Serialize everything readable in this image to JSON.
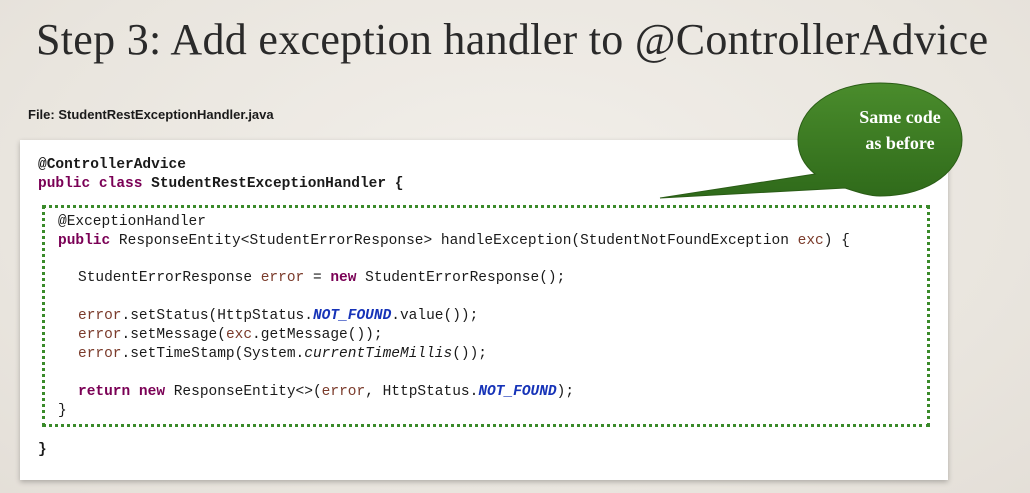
{
  "slide": {
    "title": "Step 3:  Add exception handler to @ControllerAdvice",
    "file_label": "File: StudentRestExceptionHandler.java"
  },
  "callout": {
    "line1": "Same code",
    "line2": "as before"
  },
  "code": {
    "annotation_outer": "@ControllerAdvice",
    "class_kw": "public class ",
    "class_name": "StudentRestExceptionHandler {",
    "annotation_inner": "@ExceptionHandler",
    "method_kw": "public",
    "method_sig": " ResponseEntity<StudentErrorResponse> handleException(StudentNotFoundException ",
    "method_param": "exc",
    "method_end": ") {",
    "line_new_a": "StudentErrorResponse ",
    "line_new_var": "error",
    "line_new_b": " = ",
    "line_new_kw": "new",
    "line_new_c": " StudentErrorResponse();",
    "status_var": "error",
    "status_a": ".setStatus(HttpStatus.",
    "status_const": "NOT_FOUND",
    "status_b": ".value());",
    "msg_var": "error",
    "msg_a": ".setMessage(",
    "msg_param": "exc",
    "msg_b": ".getMessage());",
    "ts_var": "error",
    "ts_a": ".setTimeStamp(System.",
    "ts_ital": "currentTimeMillis",
    "ts_b": "());",
    "ret_kw1": "return",
    "ret_kw2": "new",
    "ret_a": " ResponseEntity<>(",
    "ret_var": "error",
    "ret_b": ", HttpStatus.",
    "ret_const": "NOT_FOUND",
    "ret_c": ");",
    "inner_close": "}",
    "outer_close": "}"
  },
  "colors": {
    "keyword": "#7a0055",
    "constant": "#1633b8",
    "variable": "#7a3a2a",
    "callout_fill": "#3c7a22",
    "dotted_border": "#3a8a2a"
  }
}
